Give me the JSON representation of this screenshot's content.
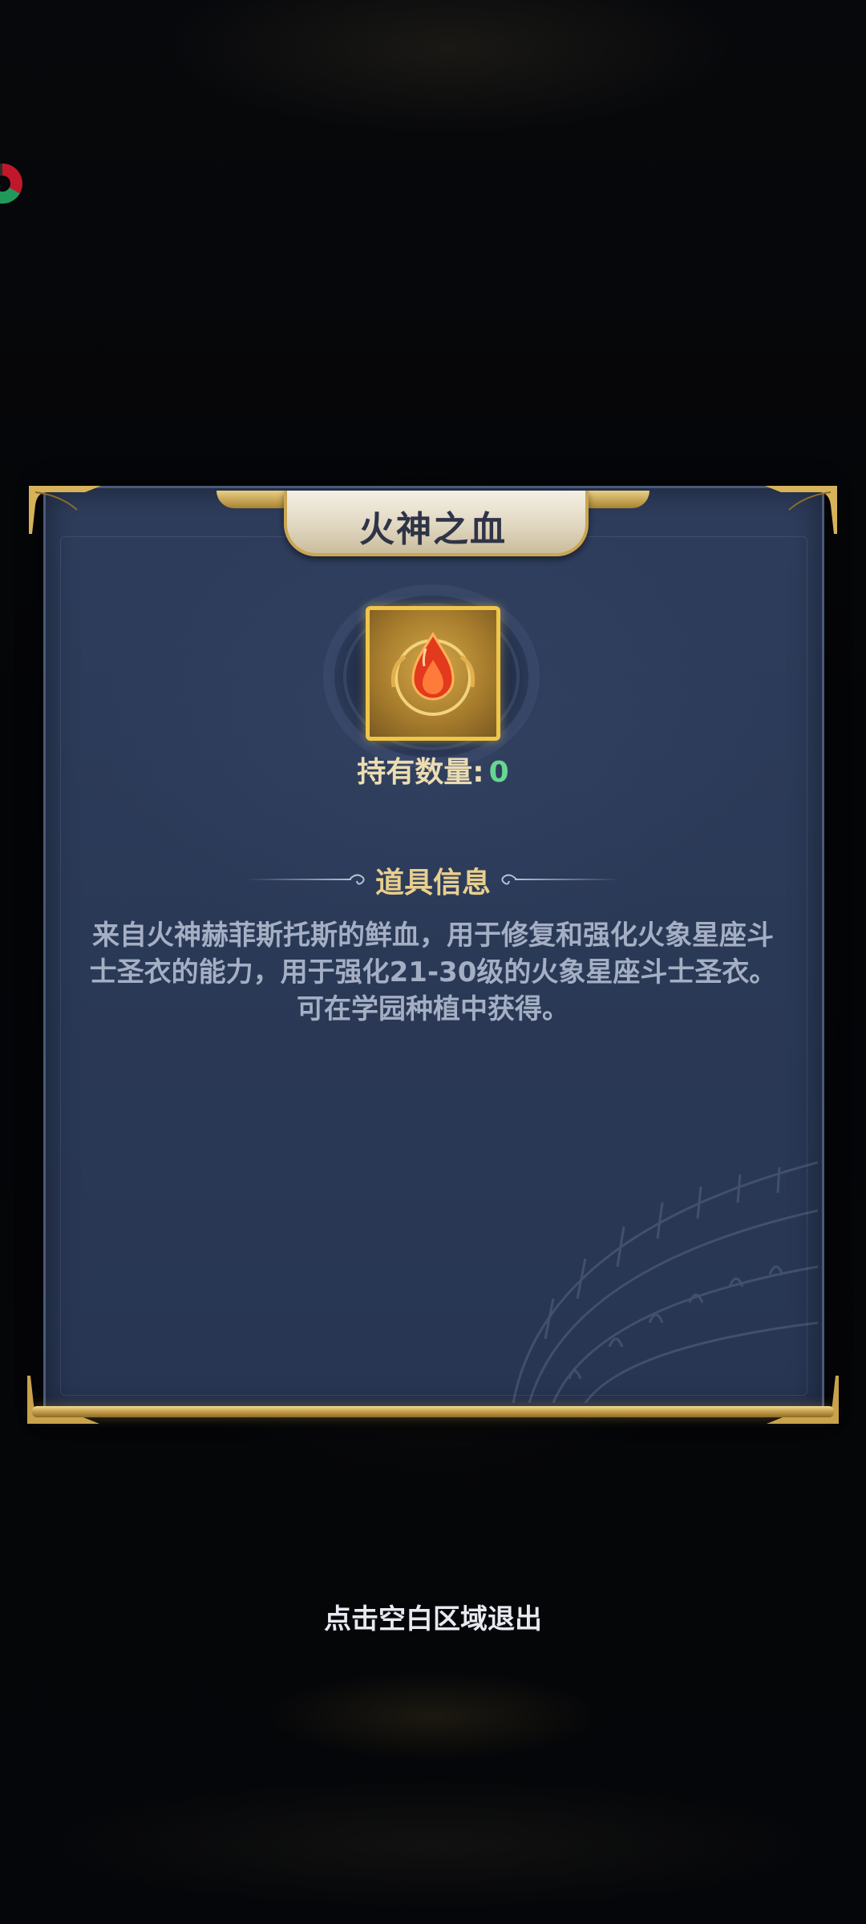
{
  "dialog": {
    "title": "火神之血",
    "item_icon": "fire-blood-drop-icon",
    "quantity_label": "持有数量:",
    "quantity_value": "0",
    "section_title": "道具信息",
    "description": "来自火神赫菲斯托斯的鲜血，用于修复和强化火象星座斗士圣衣的能力，用于强化21-30级的火象星座斗士圣衣。可在学园种植中获得。"
  },
  "exit_hint": "点击空白区域退出",
  "colors": {
    "panel_bg": "#2b3a58",
    "gold_frame": "#caa653",
    "title_text": "#2f3447",
    "quantity_value": "#66d693",
    "section_title": "#e8cf8e",
    "description_text": "#a5afc4"
  }
}
